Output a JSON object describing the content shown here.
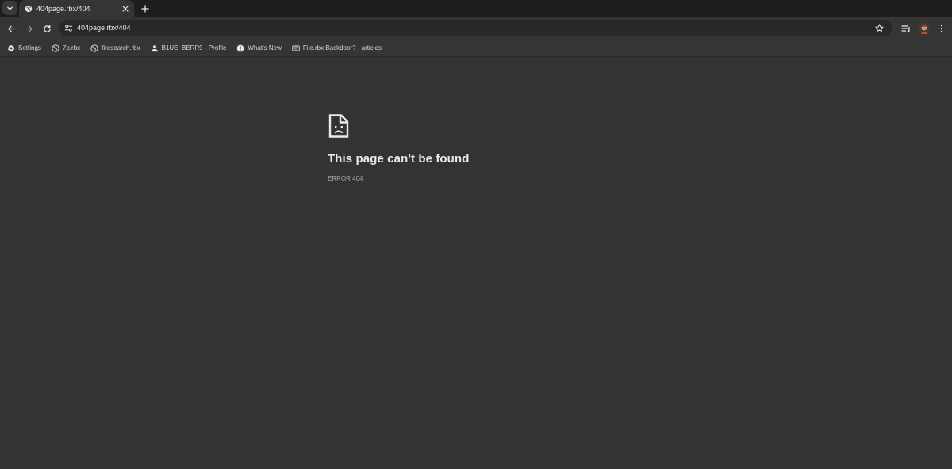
{
  "tabs": {
    "active": {
      "title": "404page.rbx/404",
      "icon": "globe-icon"
    }
  },
  "toolbar": {
    "url": "404page.rbx/404"
  },
  "bookmarks": [
    {
      "label": "Settings",
      "icon": "gear-icon"
    },
    {
      "label": "7p.rbx",
      "icon": "globe-icon"
    },
    {
      "label": "firesearch.rbx",
      "icon": "globe-icon"
    },
    {
      "label": "B1UE_BERR9 - Profile",
      "icon": "person-icon"
    },
    {
      "label": "What's New",
      "icon": "info-icon"
    },
    {
      "label": "File.rbx Backdoor? - articles",
      "icon": "reader-icon"
    }
  ],
  "error": {
    "heading": "This page can't be found",
    "code": "ERROR 404",
    "icon": "sad-document-icon"
  },
  "colors": {
    "page_bg": "#333333",
    "chrome_bg": "#353535",
    "tabstrip_bg": "#1e1e1e",
    "omnibox_bg": "#282828",
    "text": "#e8eaed"
  }
}
